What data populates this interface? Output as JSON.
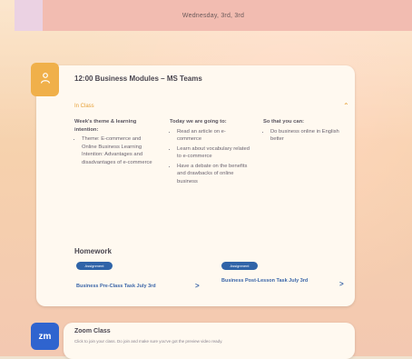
{
  "header": {
    "date": "Wednesday, 3rd, 3rd"
  },
  "event_1": {
    "icon": "person-icon",
    "title": "12:00 Business Modules – MS Teams",
    "section_label": "In Class",
    "columns": [
      {
        "heading": "Week's theme & learning intention:",
        "items": [
          "Theme: E-commerce and Online Business Learning Intention: Advantages and disadvantages of e-commerce"
        ]
      },
      {
        "heading": "Today we are going to:",
        "items": [
          "Read an article on e-commerce",
          "Learn about vocabulary related to e-commerce",
          "Have a debate on the benefits and drawbacks of online business"
        ]
      },
      {
        "heading": "So that you can:",
        "items": [
          "Do business online in English better"
        ]
      }
    ],
    "homework": {
      "title": "Homework",
      "items": [
        {
          "badge": "Assignment",
          "label": "Business Pre-Class Task July 3rd",
          "arrow": ">"
        },
        {
          "badge": "Assignment",
          "label": "Business Post-Lesson Task July 3rd",
          "arrow": ">"
        }
      ]
    }
  },
  "event_2": {
    "icon": "zoom-icon",
    "icon_text": "zm",
    "title": "Zoom Class",
    "subtitle": "Click to join your class. Do join and make sure you've got the preview video ready."
  }
}
